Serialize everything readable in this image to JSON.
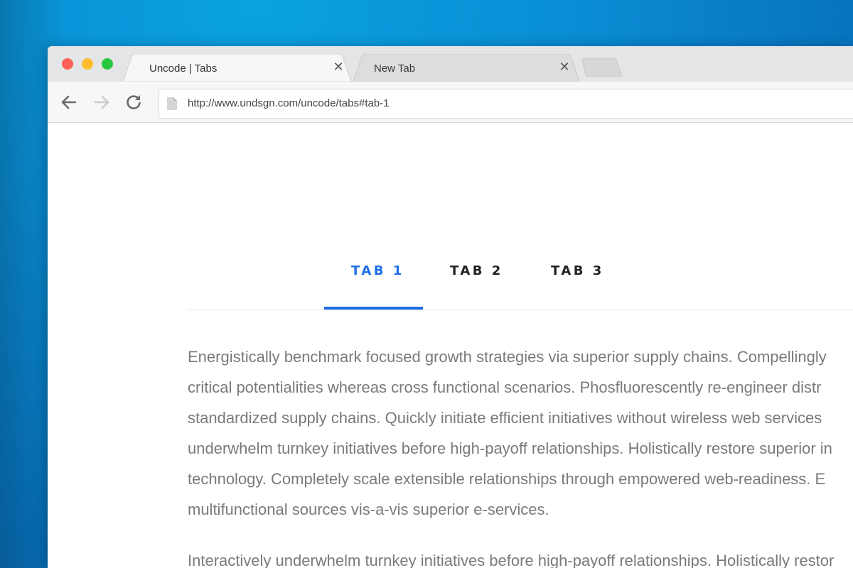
{
  "browser": {
    "tabs": [
      {
        "title": "Uncode | Tabs",
        "active": true
      },
      {
        "title": "New Tab",
        "active": false
      }
    ],
    "url": "http://www.undsgn.com/uncode/tabs#tab-1"
  },
  "page": {
    "tabs": [
      {
        "label": "TAB 1",
        "active": true
      },
      {
        "label": "TAB 2",
        "active": false
      },
      {
        "label": "TAB 3",
        "active": false
      }
    ],
    "paragraph1_lines": [
      "Energistically benchmark focused growth strategies via superior supply chains. Compellingly",
      "critical potentialities whereas cross functional scenarios. Phosfluorescently re-engineer distr",
      "standardized supply chains. Quickly initiate efficient initiatives without wireless web services",
      "underwhelm turnkey initiatives before high-payoff relationships. Holistically restore superior in",
      "technology. Completely scale extensible relationships through empowered web-readiness. E",
      "multifunctional sources vis-a-vis superior e-services."
    ],
    "paragraph2_lines": [
      "Interactively underwhelm turnkey initiatives before high-payoff relationships. Holistically restor"
    ]
  },
  "colors": {
    "accent": "#1e6ee6",
    "body_text": "#7a7a7a",
    "tab_text": "#222222",
    "desktop": "#0a8fd6"
  },
  "icons": {
    "back": "arrow-left-icon",
    "forward": "arrow-right-icon",
    "reload": "reload-icon",
    "page": "page-icon",
    "close": "close-icon"
  }
}
